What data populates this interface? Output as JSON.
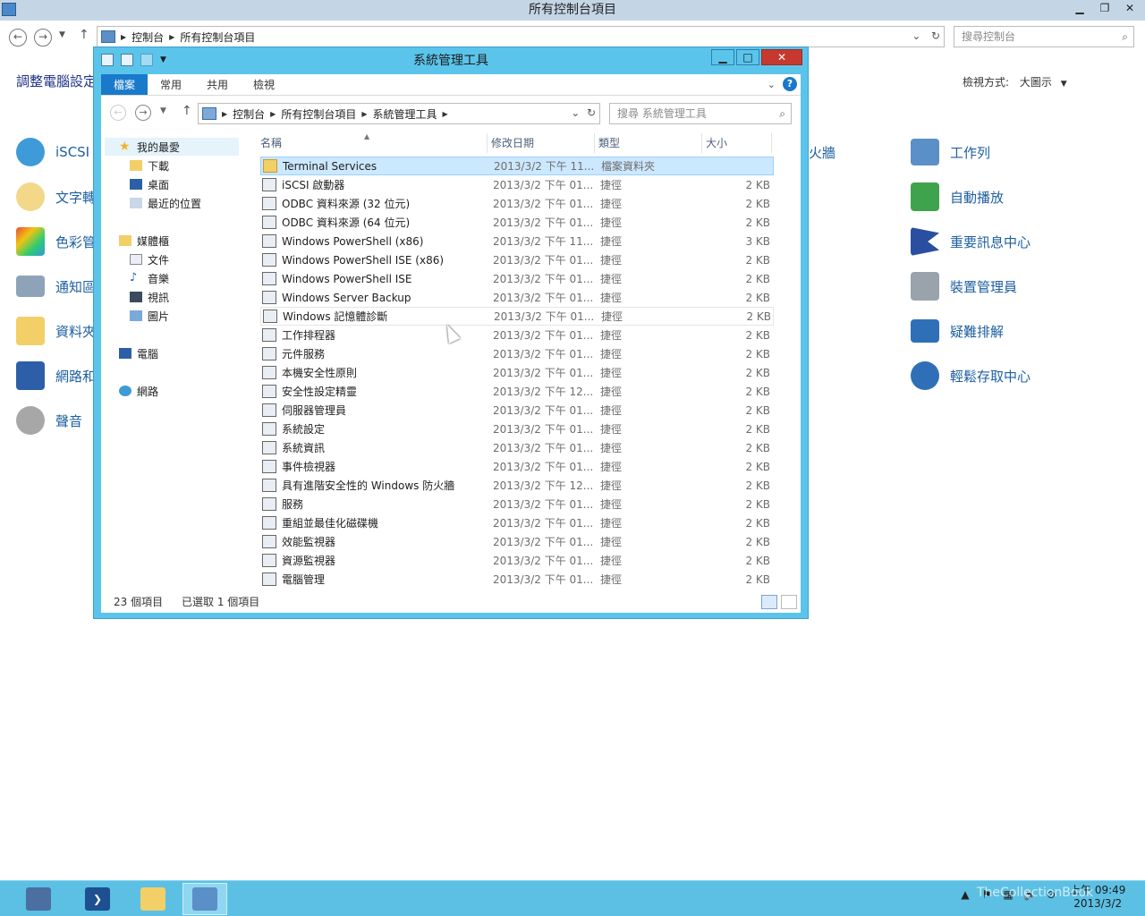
{
  "bg_window": {
    "title": "所有控制台項目",
    "breadcrumb": [
      "控制台",
      "所有控制台項目"
    ],
    "search_placeholder": "搜尋控制台",
    "heading_partial": "調整電腦設定",
    "view_by_label": "檢視方式:",
    "view_by_value": "大圖示",
    "items_left": [
      "iSCSI",
      "文字轉",
      "色彩管",
      "通知區",
      "資料夾",
      "網路和",
      "聲音"
    ],
    "item_partial_mid": "火牆",
    "items_right": [
      "工作列",
      "自動播放",
      "重要訊息中心",
      "裝置管理員",
      "疑難排解",
      "輕鬆存取中心"
    ]
  },
  "explorer": {
    "title": "系統管理工具",
    "ribbon_tabs": [
      "檔案",
      "常用",
      "共用",
      "檢視"
    ],
    "breadcrumb": [
      "控制台",
      "所有控制台項目",
      "系統管理工具"
    ],
    "search_placeholder": "搜尋 系統管理工具",
    "nav_tree": {
      "favorites": "我的最愛",
      "favorites_items": [
        "下載",
        "桌面",
        "最近的位置"
      ],
      "libraries": "媒體櫃",
      "libraries_items": [
        "文件",
        "音樂",
        "視訊",
        "圖片"
      ],
      "computer": "電腦",
      "network": "網路"
    },
    "columns": [
      "名稱",
      "修改日期",
      "類型",
      "大小"
    ],
    "rows": [
      {
        "name": "Terminal Services",
        "date": "2013/3/2 下午 11...",
        "type": "檔案資料夾",
        "size": ""
      },
      {
        "name": "iSCSI 啟動器",
        "date": "2013/3/2 下午 01...",
        "type": "捷徑",
        "size": "2 KB"
      },
      {
        "name": "ODBC 資料來源 (32 位元)",
        "date": "2013/3/2 下午 01...",
        "type": "捷徑",
        "size": "2 KB"
      },
      {
        "name": "ODBC 資料來源 (64 位元)",
        "date": "2013/3/2 下午 01...",
        "type": "捷徑",
        "size": "2 KB"
      },
      {
        "name": "Windows PowerShell (x86)",
        "date": "2013/3/2 下午 11...",
        "type": "捷徑",
        "size": "3 KB"
      },
      {
        "name": "Windows PowerShell ISE (x86)",
        "date": "2013/3/2 下午 01...",
        "type": "捷徑",
        "size": "2 KB"
      },
      {
        "name": "Windows PowerShell ISE",
        "date": "2013/3/2 下午 01...",
        "type": "捷徑",
        "size": "2 KB"
      },
      {
        "name": "Windows Server Backup",
        "date": "2013/3/2 下午 01...",
        "type": "捷徑",
        "size": "2 KB"
      },
      {
        "name": "Windows 記憶體診斷",
        "date": "2013/3/2 下午 01...",
        "type": "捷徑",
        "size": "2 KB"
      },
      {
        "name": "工作排程器",
        "date": "2013/3/2 下午 01...",
        "type": "捷徑",
        "size": "2 KB"
      },
      {
        "name": "元件服務",
        "date": "2013/3/2 下午 01...",
        "type": "捷徑",
        "size": "2 KB"
      },
      {
        "name": "本機安全性原則",
        "date": "2013/3/2 下午 01...",
        "type": "捷徑",
        "size": "2 KB"
      },
      {
        "name": "安全性設定精靈",
        "date": "2013/3/2 下午 12...",
        "type": "捷徑",
        "size": "2 KB"
      },
      {
        "name": "伺服器管理員",
        "date": "2013/3/2 下午 01...",
        "type": "捷徑",
        "size": "2 KB"
      },
      {
        "name": "系統設定",
        "date": "2013/3/2 下午 01...",
        "type": "捷徑",
        "size": "2 KB"
      },
      {
        "name": "系統資訊",
        "date": "2013/3/2 下午 01...",
        "type": "捷徑",
        "size": "2 KB"
      },
      {
        "name": "事件檢視器",
        "date": "2013/3/2 下午 01...",
        "type": "捷徑",
        "size": "2 KB"
      },
      {
        "name": "具有進階安全性的 Windows 防火牆",
        "date": "2013/3/2 下午 12...",
        "type": "捷徑",
        "size": "2 KB"
      },
      {
        "name": "服務",
        "date": "2013/3/2 下午 01...",
        "type": "捷徑",
        "size": "2 KB"
      },
      {
        "name": "重組並最佳化磁碟機",
        "date": "2013/3/2 下午 01...",
        "type": "捷徑",
        "size": "2 KB"
      },
      {
        "name": "效能監視器",
        "date": "2013/3/2 下午 01...",
        "type": "捷徑",
        "size": "2 KB"
      },
      {
        "name": "資源監視器",
        "date": "2013/3/2 下午 01...",
        "type": "捷徑",
        "size": "2 KB"
      },
      {
        "name": "電腦管理",
        "date": "2013/3/2 下午 01...",
        "type": "捷徑",
        "size": "2 KB"
      }
    ],
    "status_count": "23 個項目",
    "status_selected": "已選取 1 個項目"
  },
  "taskbar": {
    "clock_time": "上午 09:49",
    "clock_date": "2013/3/2",
    "watermark": "TheCollectionBook"
  },
  "colors": {
    "window_frame": "#5bc4ea",
    "ribbon_file_tab": "#1979ca",
    "selection": "#cce8ff",
    "close_button": "#c7392f",
    "link_text": "#1e5fa0"
  }
}
